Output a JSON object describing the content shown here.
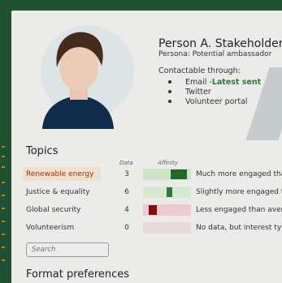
{
  "profile": {
    "name": "Person A. Stakeholder",
    "persona": "Persona: Potential ambassador",
    "contact_heading": "Contactable through:",
    "contact_methods": [
      {
        "label": "Email - ",
        "badge": "Latest sent"
      },
      {
        "label": "Twitter"
      },
      {
        "label": "Volunteer portal"
      }
    ]
  },
  "topics": {
    "title": "Topics",
    "columns": {
      "data": "Data",
      "affinity": "Affinity"
    },
    "rows": [
      {
        "label": "Renewable energy",
        "count": "3",
        "affinity": 0.75,
        "affinity_color": "#1f6b25",
        "track_color": "#cfe3c7",
        "description": "Much more engaged than average",
        "highlighted": true
      },
      {
        "label": "Justice & equality",
        "count": "6",
        "affinity": 0.55,
        "affinity_color": "#2f7a33",
        "track_color": "#d6e8cf",
        "description": "Slightly more engaged than average",
        "highlighted": false
      },
      {
        "label": "Global security",
        "count": "4",
        "affinity": 0.2,
        "affinity_color": "#8b0a0a",
        "track_color": "#eccccf",
        "description": "Less engaged than average",
        "highlighted": false
      },
      {
        "label": "Volunteerism",
        "count": "0",
        "affinity": null,
        "affinity_color": "",
        "track_color": "#e7dadc",
        "description": "No data, but interest type",
        "highlighted": false
      }
    ],
    "search_placeholder": "Search"
  },
  "format": {
    "title": "Format preferences"
  }
}
